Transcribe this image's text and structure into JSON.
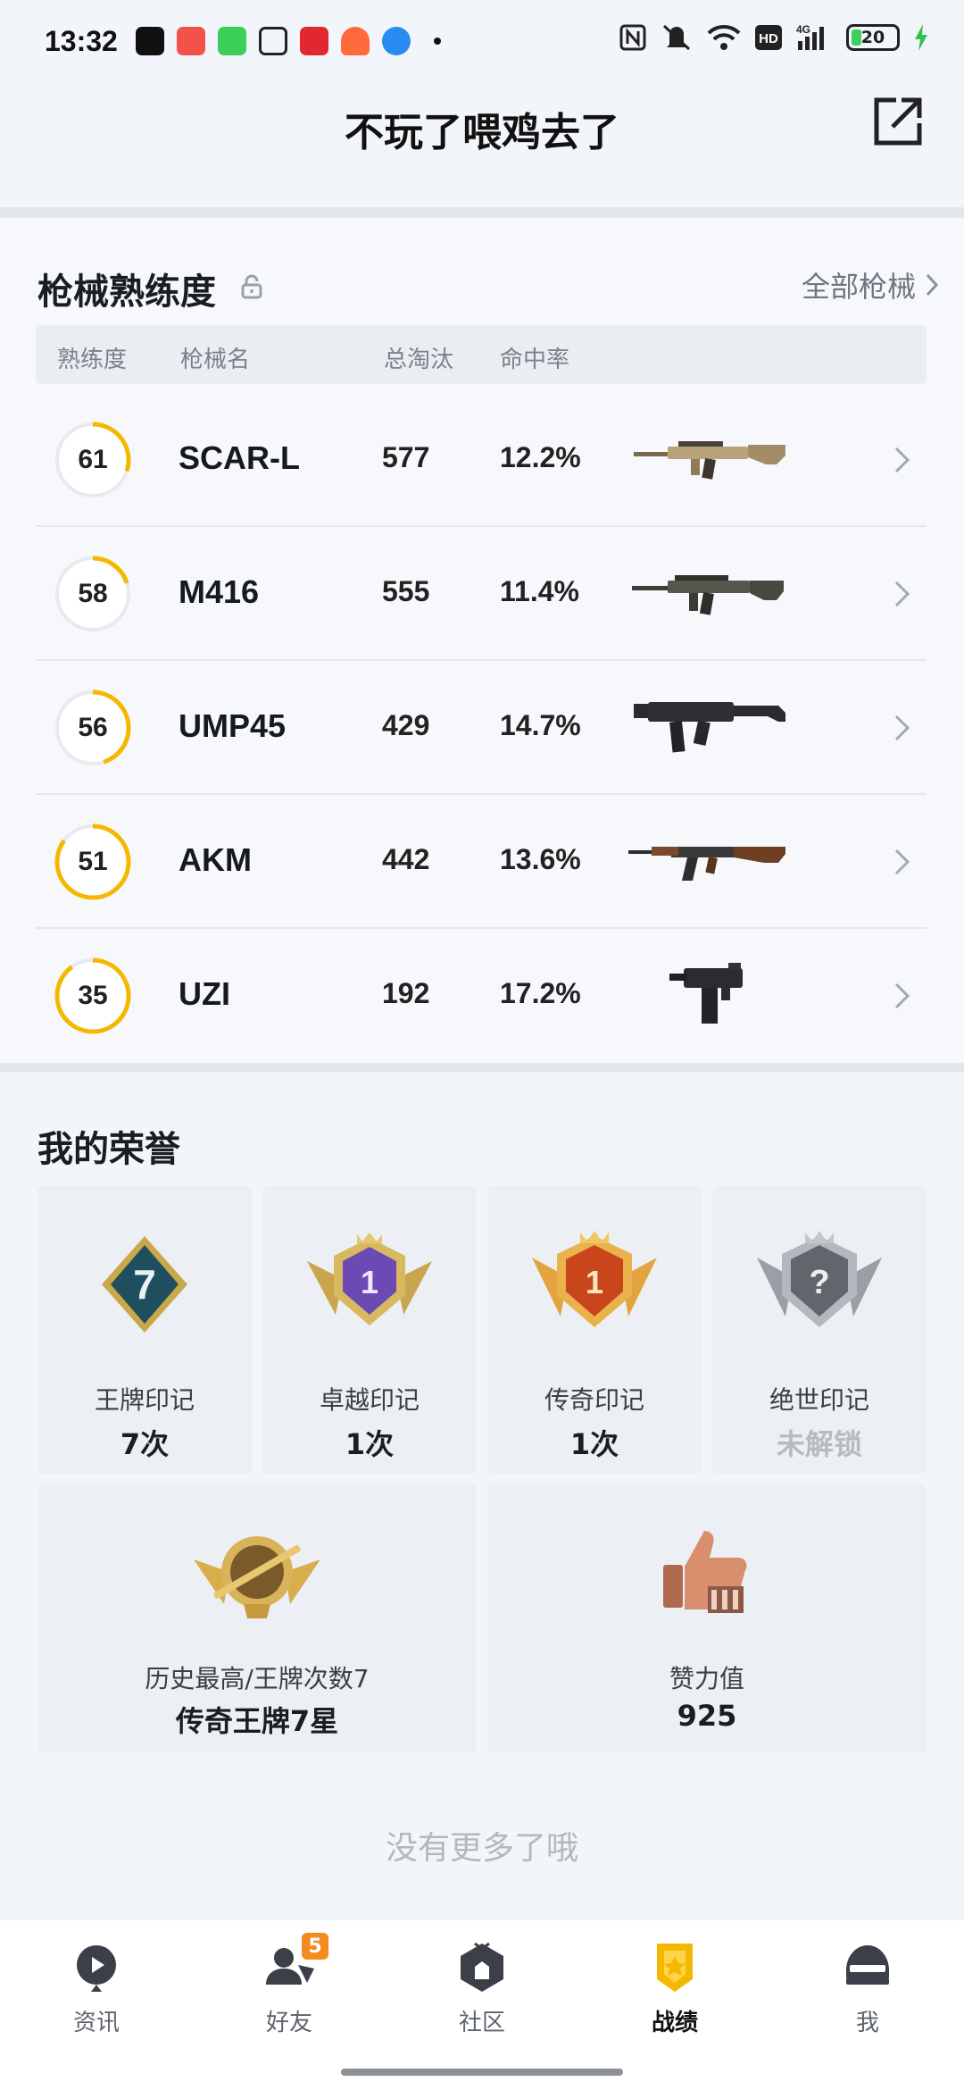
{
  "status_bar": {
    "time": "13:32",
    "battery": "20",
    "app_icons": [
      "tiktok-icon",
      "video-app-icon",
      "message-app-icon",
      "alipay-icon",
      "red-app-icon",
      "orange-app-icon",
      "blue-app-icon"
    ],
    "right_icons": [
      "nfc-icon",
      "mute-icon",
      "wifi-icon",
      "hd-icon",
      "4g-signal-icon",
      "battery-icon",
      "charging-icon"
    ]
  },
  "header": {
    "title": "不玩了喂鸡去了"
  },
  "weapons": {
    "title": "枪械熟练度",
    "all_link": "全部枪械",
    "columns": [
      "熟练度",
      "枪械名",
      "总淘汰",
      "命中率"
    ],
    "rows": [
      {
        "mastery": "61",
        "mastery_fraction": 0.3,
        "name": "SCAR-L",
        "kills": "577",
        "hit_rate": "12.2%",
        "gun_icon": "scar-l-rifle-icon"
      },
      {
        "mastery": "58",
        "mastery_fraction": 0.2,
        "name": "M416",
        "kills": "555",
        "hit_rate": "11.4%",
        "gun_icon": "m416-rifle-icon"
      },
      {
        "mastery": "56",
        "mastery_fraction": 0.45,
        "name": "UMP45",
        "kills": "429",
        "hit_rate": "14.7%",
        "gun_icon": "ump45-smg-icon"
      },
      {
        "mastery": "51",
        "mastery_fraction": 0.85,
        "name": "AKM",
        "kills": "442",
        "hit_rate": "13.6%",
        "gun_icon": "akm-rifle-icon"
      },
      {
        "mastery": "35",
        "mastery_fraction": 0.9,
        "name": "UZI",
        "kills": "192",
        "hit_rate": "17.2%",
        "gun_icon": "uzi-smg-icon"
      }
    ]
  },
  "honors": {
    "title": "我的荣誉",
    "items": [
      {
        "label": "王牌印记",
        "value": "7次",
        "badge_text": "7",
        "icon": "ace-mark-badge-icon"
      },
      {
        "label": "卓越印记",
        "value": "1次",
        "badge_text": "1",
        "icon": "excellence-mark-badge-icon"
      },
      {
        "label": "传奇印记",
        "value": "1次",
        "badge_text": "1",
        "icon": "legend-mark-badge-icon"
      },
      {
        "label": "绝世印记",
        "value": "未解锁",
        "badge_text": "?",
        "icon": "peerless-mark-badge-icon"
      }
    ],
    "wide_items": [
      {
        "label": "历史最高/王牌次数7",
        "value": "传奇王牌7星",
        "icon": "rank-emblem-icon"
      },
      {
        "label": "赞力值",
        "value": "925",
        "icon": "thumbs-up-icon"
      }
    ]
  },
  "footer_text": "没有更多了哦",
  "nav": {
    "items": [
      {
        "label": "资讯",
        "icon": "news-icon"
      },
      {
        "label": "好友",
        "icon": "friends-icon",
        "badge": "5"
      },
      {
        "label": "社区",
        "icon": "community-icon"
      },
      {
        "label": "战绩",
        "icon": "record-icon",
        "active": true
      },
      {
        "label": "我",
        "icon": "profile-helmet-icon"
      }
    ]
  },
  "colors": {
    "accent": "#f5b800",
    "background": "#f2f5f9",
    "badge_orange": "#f58b1f"
  }
}
